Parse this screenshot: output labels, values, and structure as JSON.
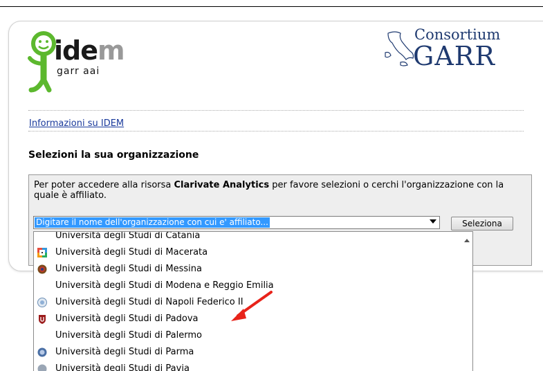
{
  "logos": {
    "idem_word": "ide",
    "idem_word_tail": "m",
    "idem_sub": "garr aai",
    "garr_top": "Consortium",
    "garr_bottom": "GARR"
  },
  "links": {
    "info": "Informazioni su IDEM"
  },
  "section": {
    "title": "Selezioni la sua organizzazione"
  },
  "instructions": {
    "part1": "Per poter accedere alla risorsa ",
    "resource": "Clarivate Analytics",
    "part2": " per favore selezioni o cerchi l'organizzazione con la quale è affiliato."
  },
  "search": {
    "value": "Digitare il nome dell'organizzazione con cui e' affiliato..."
  },
  "select_button": "Seleziona",
  "dropdown": {
    "items": [
      {
        "label": "Università degli Studi di Catania",
        "icon": "none"
      },
      {
        "label": "Università degli Studi di Macerata",
        "icon": "macerata-logo-icon"
      },
      {
        "label": "Università degli Studi di Messina",
        "icon": "messina-seal-icon"
      },
      {
        "label": "Università degli Studi di Modena e Reggio Emilia",
        "icon": "none"
      },
      {
        "label": "Università degli Studi di Napoli Federico II",
        "icon": "napoli-seal-icon"
      },
      {
        "label": "Università degli Studi di Padova",
        "icon": "padova-shield-icon"
      },
      {
        "label": "Università degli Studi di Palermo",
        "icon": "none"
      },
      {
        "label": "Università degli Studi di Parma",
        "icon": "parma-seal-icon"
      },
      {
        "label": "Università degli Studi di Pavia",
        "icon": "pavia-seal-icon"
      }
    ]
  },
  "colors": {
    "link": "#1a3a9c",
    "garr_blue": "#1f3a70",
    "idem_green": "#5cb82e",
    "selection": "#3399ff",
    "annotation_arrow": "#e8231a"
  }
}
